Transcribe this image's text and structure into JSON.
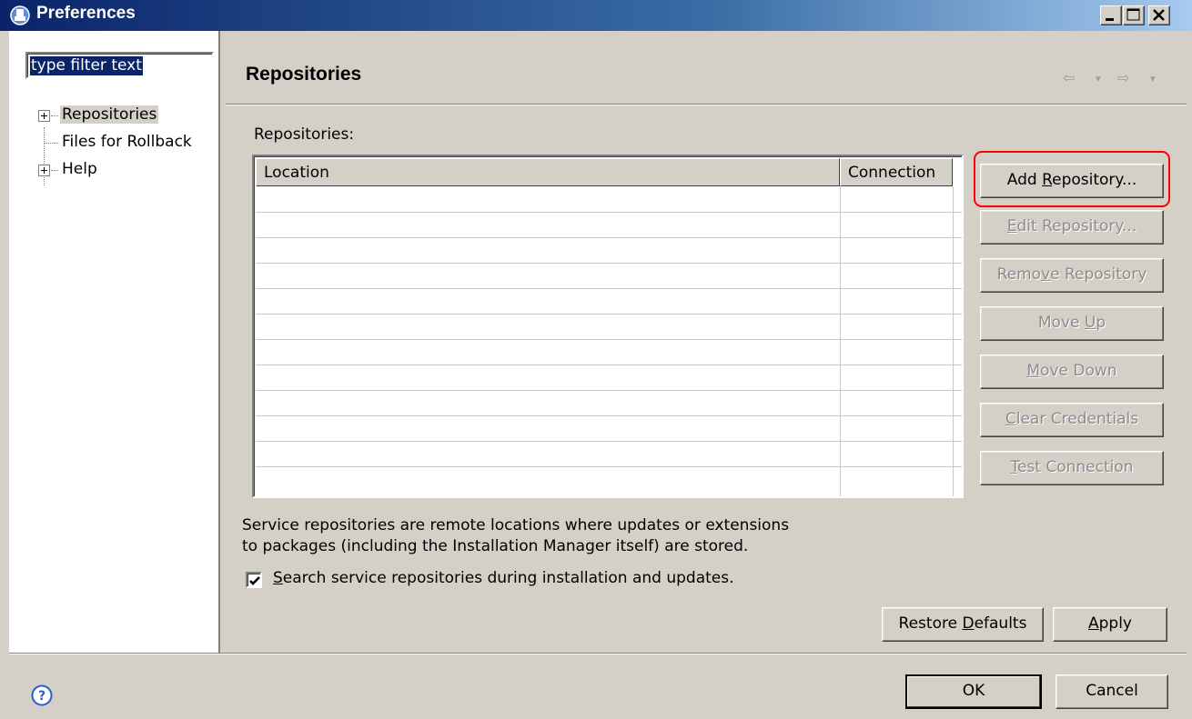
{
  "window": {
    "title": "Preferences",
    "controls": [
      "minimize",
      "maximize",
      "close"
    ]
  },
  "nav": {
    "filter_value": "type filter text",
    "tree": [
      {
        "label": "Repositories",
        "expandable": true,
        "selected": true
      },
      {
        "label": "Files for Rollback",
        "expandable": false,
        "selected": false
      },
      {
        "label": "Help",
        "expandable": true,
        "selected": false
      }
    ]
  },
  "page": {
    "title": "Repositories",
    "history_icons": [
      "back-arrow-icon",
      "back-menu-icon",
      "forward-arrow-icon",
      "forward-menu-icon"
    ]
  },
  "repositories": {
    "label": "Repositories:",
    "columns": [
      "Location",
      "Connection"
    ],
    "rows": []
  },
  "buttons": {
    "add": {
      "pre": "Add ",
      "key": "R",
      "post": "epository..."
    },
    "edit": {
      "pre": "",
      "key": "E",
      "post": "dit Repository..."
    },
    "remove": {
      "pre": "Remo",
      "key": "v",
      "post": "e Repository"
    },
    "move_up": {
      "pre": "Move ",
      "key": "U",
      "post": "p"
    },
    "move_down": {
      "pre": "",
      "key": "M",
      "post": "ove Down"
    },
    "clear": {
      "pre": "",
      "key": "C",
      "post": "lear Credentials"
    },
    "test": {
      "pre": "",
      "key": "T",
      "post": "est Connection"
    },
    "restore": {
      "pre": "Restore ",
      "key": "D",
      "post": "efaults"
    },
    "apply": {
      "pre": "",
      "key": "A",
      "post": "pply"
    },
    "ok": "OK",
    "cancel": "Cancel"
  },
  "description": {
    "line1": "Service repositories are remote locations where updates or extensions",
    "line2": "to packages (including the Installation Manager itself) are stored."
  },
  "search_option": {
    "checked": true,
    "pre": "",
    "key": "S",
    "post": "earch service repositories during installation and updates."
  },
  "colors": {
    "title_bar": "#0a246a",
    "dialog_bg": "#d4d0c8",
    "highlight_ring": "#ff0000",
    "help_icon": "#2a5bd7"
  }
}
